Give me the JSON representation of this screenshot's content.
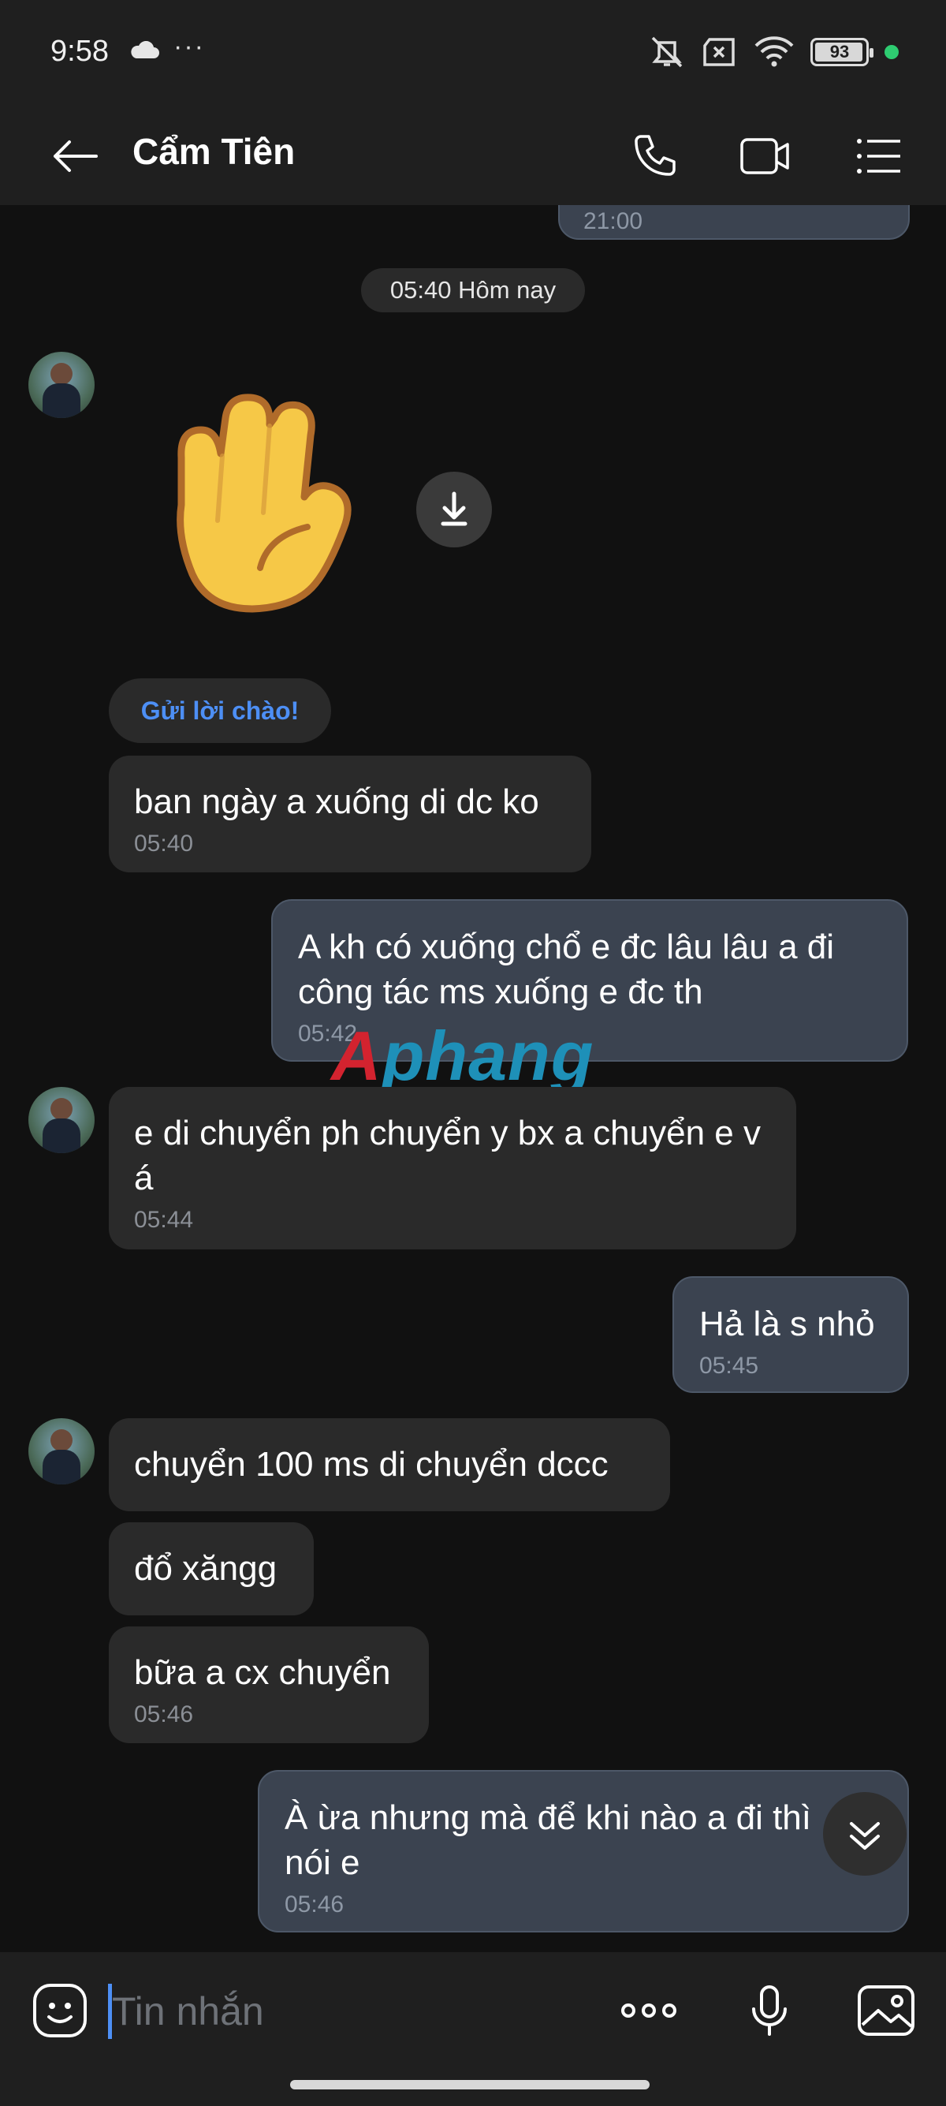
{
  "status_bar": {
    "time": "9:58",
    "dots": "···",
    "battery": "93"
  },
  "header": {
    "title": "Cẩm Tiên"
  },
  "chat": {
    "prev_time_partial": "21:00",
    "date_separator": "05:40 Hôm nay",
    "greeting_button": "Gửi lời chào!",
    "messages": [
      {
        "side": "received",
        "text": "ban ngày a xuống di dc ko",
        "time": "05:40"
      },
      {
        "side": "sent",
        "text": "A kh có xuống chổ e đc lâu lâu a đi công tác ms xuống e đc th",
        "time": "05:42"
      },
      {
        "side": "received",
        "text": "e di chuyển ph chuyển y bx a chuyển e v á",
        "time": "05:44"
      },
      {
        "side": "sent",
        "text": "Hả là s nhỏ",
        "time": "05:45"
      },
      {
        "side": "received",
        "text": "chuyển 100 ms di chuyển dccc",
        "time": ""
      },
      {
        "side": "received",
        "text": "đổ xăngg",
        "time": ""
      },
      {
        "side": "received",
        "text": "bữa a cx chuyển",
        "time": "05:46"
      },
      {
        "side": "sent",
        "text": "À ừa nhưng mà để khi nào a đi thì nói e",
        "time": "05:46"
      }
    ]
  },
  "watermark": {
    "first": "A",
    "rest": "phang"
  },
  "input": {
    "placeholder": "Tin nhắn"
  },
  "colors": {
    "background": "#111111",
    "bar": "#1f1f1f",
    "received_bubble": "#2a2a2a",
    "sent_bubble": "#3b4350",
    "accent": "#4d8ff5"
  }
}
